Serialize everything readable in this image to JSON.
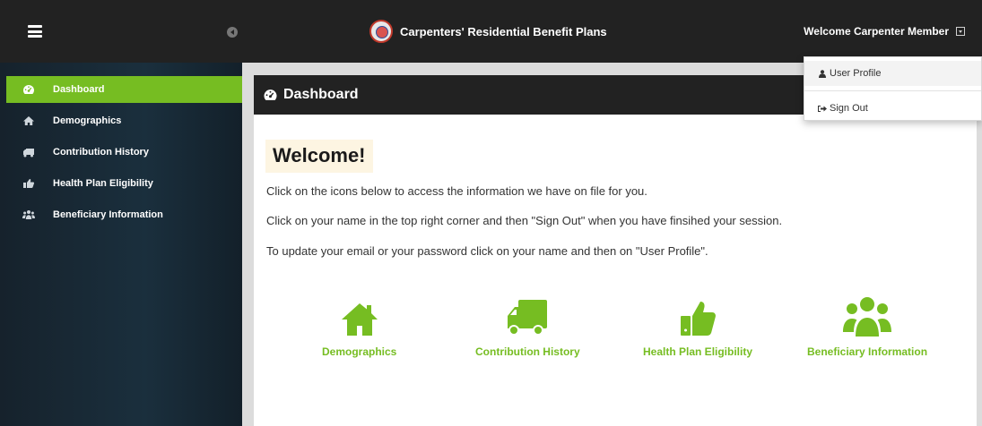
{
  "header": {
    "brand_name": "Carpenters' Residential Benefit Plans",
    "user_name": "Welcome Carpenter Member"
  },
  "user_menu": {
    "items": [
      {
        "label": "User Profile",
        "icon": "user-icon"
      },
      {
        "label": "Sign Out",
        "icon": "sign-out-icon"
      }
    ]
  },
  "sidebar": {
    "items": [
      {
        "label": "Dashboard",
        "icon": "dashboard-icon",
        "active": true
      },
      {
        "label": "Demographics",
        "icon": "home-icon"
      },
      {
        "label": "Contribution History",
        "icon": "truck-icon"
      },
      {
        "label": "Health Plan Eligibility",
        "icon": "thumbs-up-icon"
      },
      {
        "label": "Beneficiary Information",
        "icon": "users-icon"
      }
    ]
  },
  "main": {
    "title": "Dashboard",
    "welcome": "Welcome!",
    "lines": [
      "Click on the icons below to access the information we have on file for you.",
      "Click on your name in the top right corner and then \"Sign Out\" when you have finsihed your session.",
      "To update your email or your password click on your name and then on \"User Profile\"."
    ],
    "tiles": [
      {
        "label": "Demographics",
        "icon": "home-icon"
      },
      {
        "label": "Contribution History",
        "icon": "truck-icon"
      },
      {
        "label": "Health Plan Eligibility",
        "icon": "thumbs-up-icon"
      },
      {
        "label": "Beneficiary Information",
        "icon": "users-icon"
      }
    ]
  },
  "colors": {
    "accent": "#76bd22",
    "topbar": "#222222",
    "sidebar": "#1a2f3d"
  }
}
